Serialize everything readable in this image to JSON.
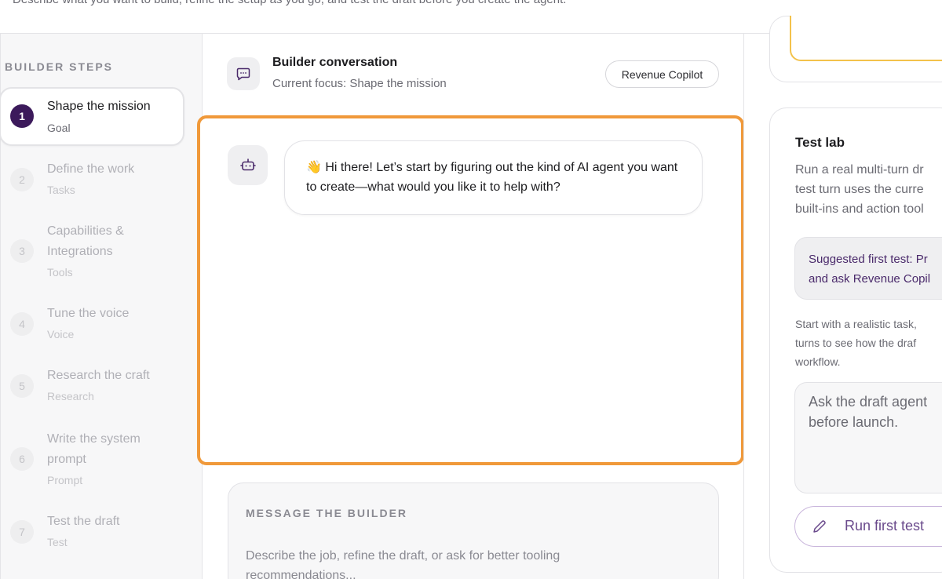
{
  "page": {
    "description": "Describe what you want to build, refine the setup as you go, and test the draft before you create the agent."
  },
  "sidebar": {
    "title": "BUILDER STEPS",
    "steps": [
      {
        "num": "1",
        "label": "Shape the mission",
        "sub": "Goal",
        "active": true
      },
      {
        "num": "2",
        "label": "Define the work",
        "sub": "Tasks"
      },
      {
        "num": "3",
        "label": "Capabilities & Integrations",
        "sub": "Tools"
      },
      {
        "num": "4",
        "label": "Tune the voice",
        "sub": "Voice"
      },
      {
        "num": "5",
        "label": "Research the craft",
        "sub": "Research"
      },
      {
        "num": "6",
        "label": "Write the system prompt",
        "sub": "Prompt"
      },
      {
        "num": "7",
        "label": "Test the draft",
        "sub": "Test"
      }
    ]
  },
  "conversation": {
    "title": "Builder conversation",
    "focus": "Current focus: Shape the mission",
    "agent_pill": "Revenue Copilot",
    "message": "👋 Hi there! Let’s start by figuring out the kind of AI agent you want to create—what would you like it to help with?",
    "icon": "chat-bubble-icon",
    "avatar_icon": "robot-icon"
  },
  "composer": {
    "heading": "MESSAGE THE BUILDER",
    "placeholder": "Describe the job, refine the draft, or ask for better tooling recommendations..."
  },
  "test_lab": {
    "title": "Test lab",
    "intro_lines": [
      "Run a real multi-turn dr",
      "test turn uses the curre",
      "built-ins and action tool"
    ],
    "suggest_lines": [
      "Suggested first test: Pr",
      "and ask Revenue Copil"
    ],
    "note_lines": [
      "Start with a realistic task,",
      "turns to see how the draf",
      "workflow."
    ],
    "input_lines": [
      "Ask the draft agent",
      "before launch."
    ],
    "run_button": "Run first test"
  },
  "colors": {
    "accent": "#3c1a5b",
    "highlight_border": "#f0993a",
    "top_card_border": "#f3c24b"
  }
}
